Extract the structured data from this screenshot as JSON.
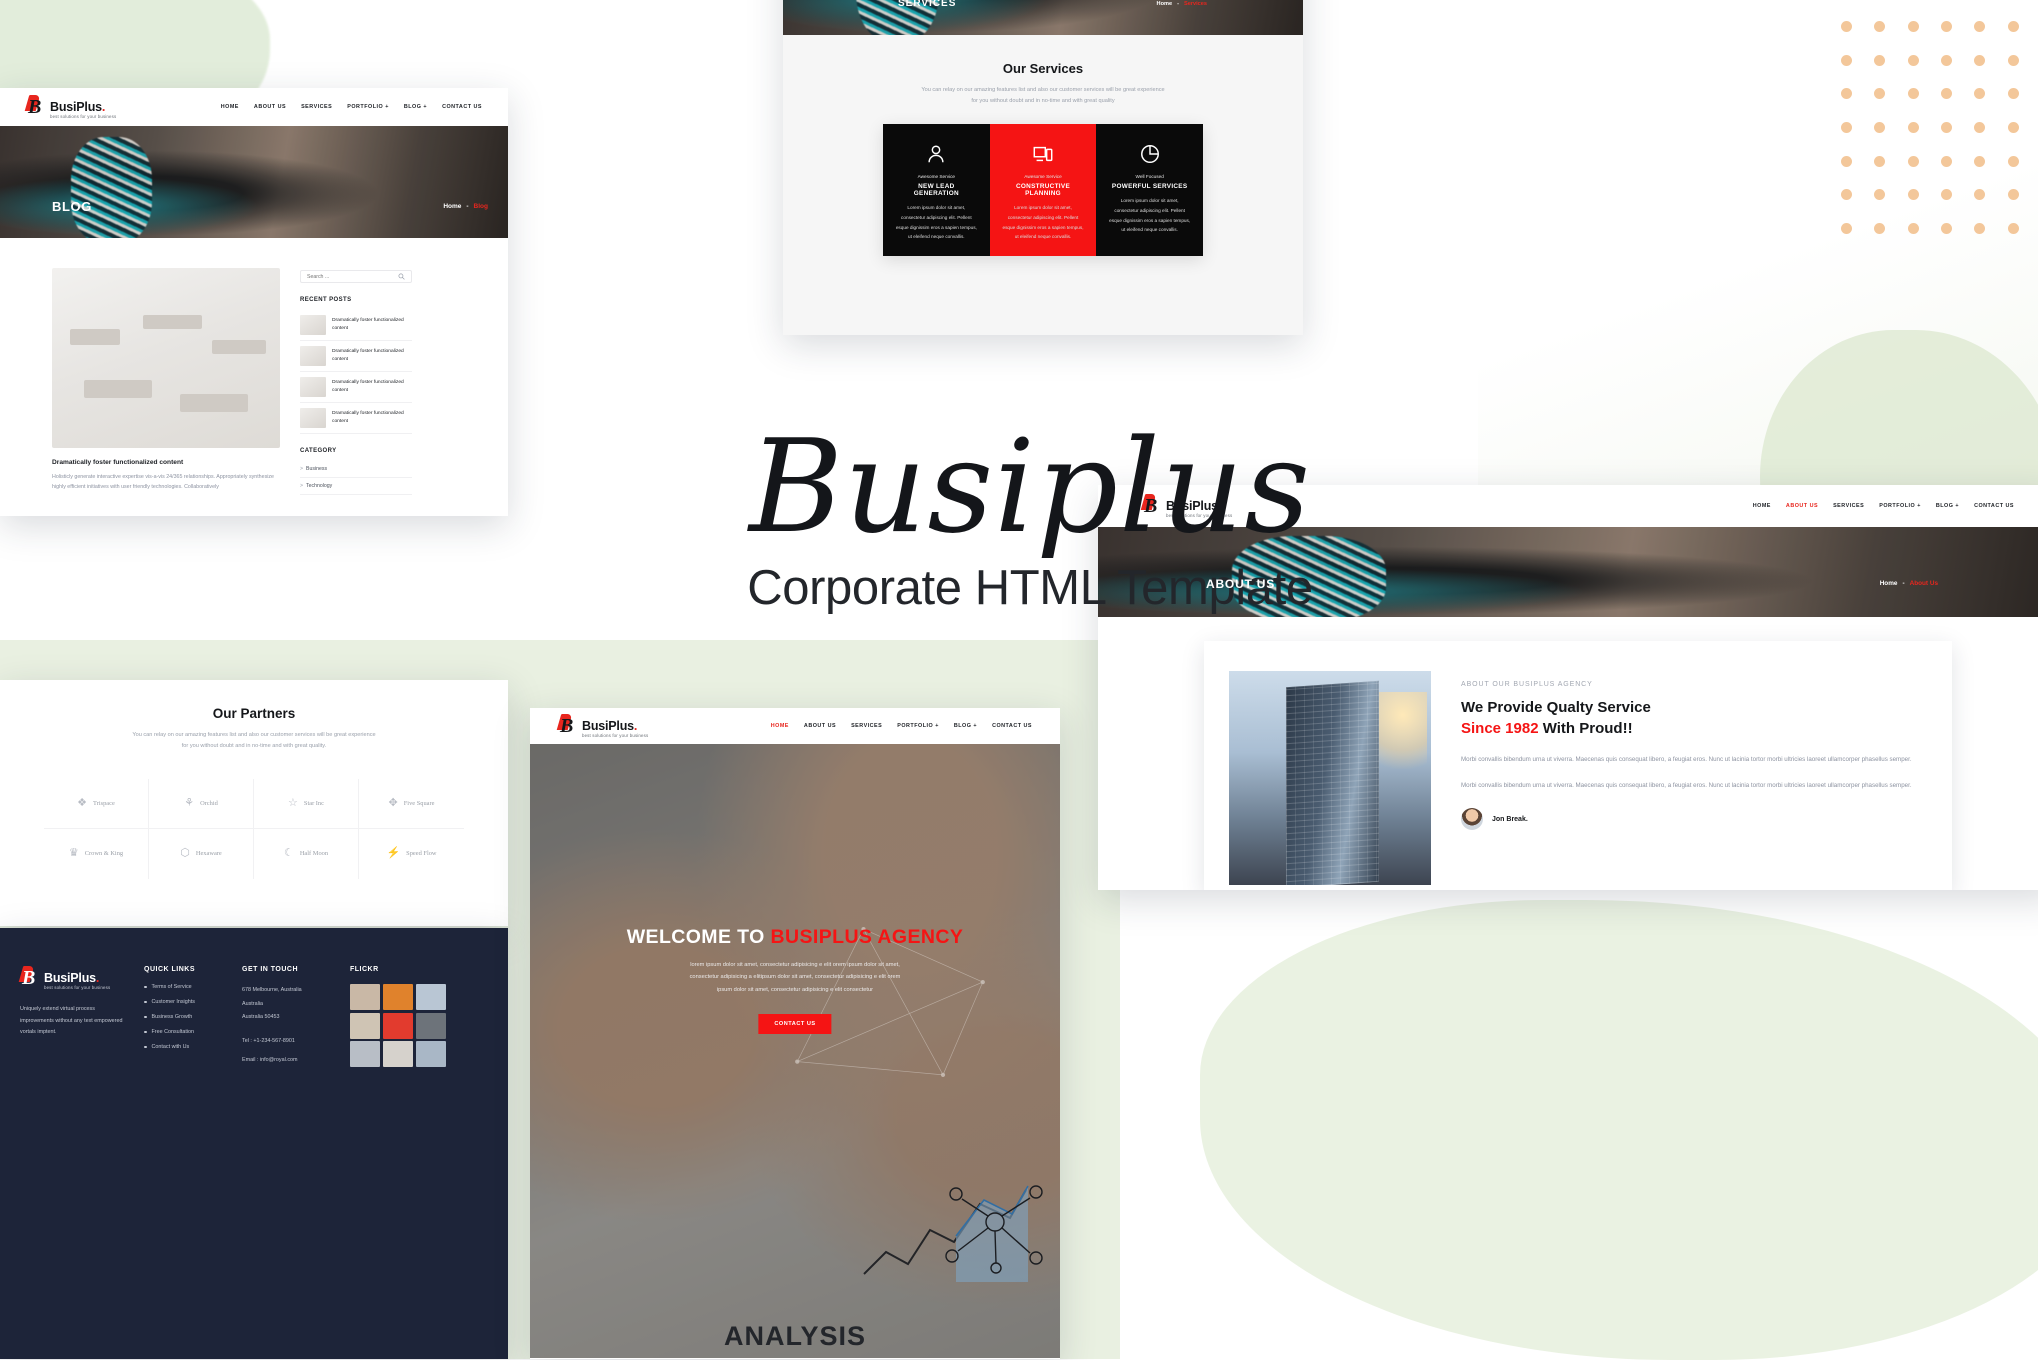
{
  "brand": {
    "name": "BusiPlus",
    "dot": ".",
    "tagline": "best solutions for your business"
  },
  "hero_title": {
    "word": "Busiplus",
    "subtitle": "Corporate HTML Template"
  },
  "nav": {
    "items": [
      {
        "label": "HOME",
        "active": false
      },
      {
        "label": "ABOUT US",
        "active": false
      },
      {
        "label": "SERVICES",
        "active": false
      },
      {
        "label": "PORTFOLIO +",
        "active": false
      },
      {
        "label": "BLOG +",
        "active": false
      },
      {
        "label": "CONTACT US",
        "active": false
      }
    ],
    "home_active": [
      {
        "label": "HOME",
        "active": true
      },
      {
        "label": "ABOUT US",
        "active": false
      },
      {
        "label": "SERVICES",
        "active": false
      },
      {
        "label": "PORTFOLIO +",
        "active": false
      },
      {
        "label": "BLOG +",
        "active": false
      },
      {
        "label": "CONTACT US",
        "active": false
      }
    ],
    "about_active": [
      {
        "label": "HOME",
        "active": false
      },
      {
        "label": "ABOUT US",
        "active": true
      },
      {
        "label": "SERVICES",
        "active": false
      },
      {
        "label": "PORTFOLIO +",
        "active": false
      },
      {
        "label": "BLOG +",
        "active": false
      },
      {
        "label": "CONTACT US",
        "active": false
      }
    ]
  },
  "blog_page": {
    "title": "BLOG",
    "breadcrumb_home": "Home",
    "breadcrumb_sep": "-",
    "breadcrumb_current": "Blog",
    "post": {
      "title": "Dramatically foster functionalized content",
      "excerpt": "Holisticly generate interactive expertise vis-a-vis 24/365 relationships. Appropriately synthesize highly efficient initiatives with user friendly technologies. Collaboratively"
    },
    "search_placeholder": "Search ...",
    "search_icon": "search-icon",
    "recent_posts_heading": "RECENT POSTS",
    "recent_posts": [
      {
        "title": "Dramatically foster functionalized content"
      },
      {
        "title": "Dramatically foster functionalized content"
      },
      {
        "title": "Dramatically foster functionalized content"
      },
      {
        "title": "Dramatically foster functionalized content"
      }
    ],
    "category_heading": "CATEGORY",
    "categories": [
      {
        "label": "Business",
        "marker": ">"
      },
      {
        "label": "Technology",
        "marker": ">"
      }
    ]
  },
  "services_page": {
    "title": "SERVICES",
    "breadcrumb_home": "Home",
    "breadcrumb_sep": "-",
    "breadcrumb_current": "Services",
    "heading": "Our Services",
    "sub_line1": "You can relay on our amazing features list and also our customer services will be great experience",
    "sub_line2": "for you without doubt and in no-time and with great quality",
    "cards": [
      {
        "icon": "user-icon",
        "pre": "Awesome Service",
        "title": "NEW LEAD GENERATION",
        "text": "Lorem ipsum dolor sit amet, consectetur adipiscing elit. Pellent esque dignissim eros a sapien tempus, ut eleifend neque convallis.",
        "highlight": false
      },
      {
        "icon": "devices-icon",
        "pre": "Awesome Service",
        "title": "CONSTRUCTIVE PLANNING",
        "text": "Lorem ipsum dolor sit amet, consectetur adipiscing elit. Pellent esque dignissim eros a sapien tempus, ut eleifend neque convallis.",
        "highlight": true
      },
      {
        "icon": "pie-chart-icon",
        "pre": "Well Focused",
        "title": "POWERFUL SERVICES",
        "text": "Lorem ipsum dolor sit amet, consectetur adipiscing elit. Pellent esque dignissim eros a sapien tempus, ut eleifend neque convallis.",
        "highlight": false
      }
    ]
  },
  "about_page": {
    "title": "ABOUT US",
    "breadcrumb_home": "Home",
    "breadcrumb_sep": "-",
    "breadcrumb_current": "About Us",
    "pre_heading": "ABOUT OUR BUSIPLUS AGENCY",
    "heading_line1": "We Provide Qualty Service",
    "heading_red": "Since 1982",
    "heading_line2_rest": " With Proud!!",
    "paragraph1": "Morbi convallis bibendum urna ut viverra. Maecenas quis consequat libero, a feugiat eros. Nunc ut lacinia tortor morbi ultricies laoreet ullamcorper phasellus semper.",
    "paragraph2": "Morbi convallis bibendum urna ut viverra. Maecenas quis consequat libero, a feugiat eros. Nunc ut lacinia tortor morbi ultricies laoreet ullamcorper phasellus semper.",
    "person_name": "Jon Break."
  },
  "partners_page": {
    "heading": "Our Partners",
    "sub_line1": "You can relay on our amazing features list and also our customer services will be great experience",
    "sub_line2": "for you without doubt and in no-time and with great quality.",
    "partners": [
      {
        "name": "Trispace",
        "icon": "diamonds-icon",
        "glyph": "❖"
      },
      {
        "name": "Orchid",
        "icon": "plant-icon",
        "glyph": "⚘"
      },
      {
        "name": "Star Inc",
        "icon": "star-outline-icon",
        "glyph": "☆"
      },
      {
        "name": "Five Square",
        "icon": "four-dots-icon",
        "glyph": "✥"
      },
      {
        "name": "Crown & King",
        "icon": "crown-icon",
        "glyph": "♛"
      },
      {
        "name": "Hexaware",
        "icon": "hexagon-icon",
        "glyph": "⬡"
      },
      {
        "name": "Half Moon",
        "icon": "moon-icon",
        "glyph": "☾"
      },
      {
        "name": "Speed Flow",
        "icon": "speed-icon",
        "glyph": "⚡"
      }
    ]
  },
  "home_page": {
    "hero_welcome": "WELCOME TO ",
    "hero_agency": "BUSIPLUS AGENCY",
    "hero_p1": "lorem ipsum dolor sit amet, consectetur adipisicing e elit orem ipsum dolor sit amet,",
    "hero_p2": "consectetur adipisicing a elitipsum dolor sit amet, consectetur adipisicing e elit orem",
    "hero_p3": "ipsum dolor sit amet, consectetur adipisicing e elit consectetur",
    "cta_label": "CONTACT US",
    "analysis_word": "ANALYSIS"
  },
  "footer": {
    "about_text": "Uniquely extend virtual process improvements without any text empowered vortals imptent.",
    "quick_links_heading": "QUICK LINKS",
    "quick_links": [
      "Terms of Service",
      "Customer Insights",
      "Business Growth",
      "Free Consultation",
      "Contact with Us"
    ],
    "get_in_touch_heading": "GET IN TOUCH",
    "address_lines": [
      "678 Melbourne, Australia",
      "Australia",
      "Australia 50453"
    ],
    "phone": "Tel : +1-234-567-8901",
    "email": "Email : info@royal.com",
    "flickr_heading": "FLICKR",
    "flickr_colors": [
      "#c9b8a6",
      "#e0822c",
      "#b9c6d4",
      "#cfc4b4",
      "#e23b2e",
      "#6d737a",
      "#b8bec6",
      "#d6d2cc",
      "#a9b7c6"
    ]
  },
  "colors": {
    "accent_red": "#f51414",
    "dark": "#0a0a0a",
    "footer_bg": "#1d2439",
    "muted": "#9aa0ab",
    "green_bg": "#e9f0e1",
    "dot_orange": "#f3c79a"
  }
}
